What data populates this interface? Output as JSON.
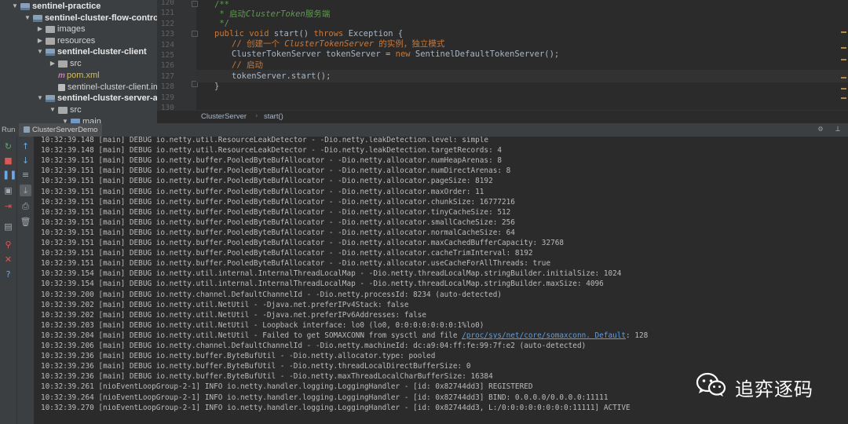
{
  "project_tree": {
    "items": [
      {
        "label": "sentinel-practice",
        "arrow": "▼",
        "icon": "module",
        "depth": 0,
        "bold": true
      },
      {
        "label": "sentinel-cluster-flow-control",
        "arrow": "▼",
        "icon": "module",
        "depth": 1,
        "bold": true
      },
      {
        "label": "images",
        "arrow": "▶",
        "icon": "folder",
        "depth": 2,
        "bold": false
      },
      {
        "label": "resources",
        "arrow": "▶",
        "icon": "folder",
        "depth": 2,
        "bold": false
      },
      {
        "label": "sentinel-cluster-client",
        "arrow": "▼",
        "icon": "module",
        "depth": 2,
        "bold": true
      },
      {
        "label": "src",
        "arrow": "▶",
        "icon": "folder",
        "depth": 3,
        "bold": false
      },
      {
        "label": "pom.xml",
        "arrow": "",
        "icon": "maven",
        "depth": 3,
        "bold": false,
        "pom": true
      },
      {
        "label": "sentinel-cluster-client.iml",
        "arrow": "",
        "icon": "file",
        "depth": 3,
        "bold": false
      },
      {
        "label": "sentinel-cluster-server-alone",
        "arrow": "▼",
        "icon": "module",
        "depth": 2,
        "bold": true
      },
      {
        "label": "src",
        "arrow": "▼",
        "icon": "folder",
        "depth": 3,
        "bold": false
      },
      {
        "label": "main",
        "arrow": "▼",
        "icon": "srcfolder",
        "depth": 4,
        "bold": false
      }
    ]
  },
  "editor": {
    "line_numbers": [
      "120",
      "121",
      "122",
      "123",
      "124",
      "125",
      "126",
      "127",
      "128",
      "129",
      "130"
    ],
    "code": {
      "l120": "/**",
      "l121_prefix": " * 启动",
      "l121_italic": "ClusterToken",
      "l121_suffix": "服务端",
      "l122": " */",
      "l123_kw1": "public void",
      "l123_mid": " start() ",
      "l123_kw2": "throws",
      "l123_end": " Exception {",
      "l124_prefix": "// 创建一个 ",
      "l124_italic": "ClusterTokenServer",
      "l124_suffix": " 的实例，独立模式",
      "l125_a": "ClusterTokenServer tokenServer = ",
      "l125_kw": "new",
      "l125_b": " SentinelDefaultTokenServer();",
      "l126": "// 启动",
      "l127": "tokenServer.start();",
      "l128": "}"
    }
  },
  "breadcrumb": {
    "class_name": "ClusterServer",
    "method": "start()"
  },
  "run_panel": {
    "label": "Run",
    "tab": "ClusterServerDemo",
    "settings_glyph": "⚙",
    "minimize_glyph": "⊥"
  },
  "toolbar_a": [
    {
      "name": "rerun-icon",
      "glyph": "↻",
      "color": "#59a869"
    },
    {
      "name": "stop-icon",
      "glyph": "■",
      "color": "#e05555"
    },
    {
      "name": "pause-icon",
      "glyph": "❚❚",
      "color": "#6aa9e6"
    },
    {
      "name": "dump-threads-icon",
      "glyph": "▣",
      "color": "#a0a8b0"
    },
    {
      "name": "exit-icon",
      "glyph": "⇥",
      "color": "#e05555"
    },
    {
      "name": "layout-icon",
      "glyph": "▤",
      "color": "#a0a8b0"
    },
    {
      "name": "pin-icon",
      "glyph": "⚲",
      "color": "#e05555"
    },
    {
      "name": "close-icon",
      "glyph": "✕",
      "color": "#e05555"
    },
    {
      "name": "help-icon",
      "glyph": "?",
      "color": "#6aa9e6"
    }
  ],
  "toolbar_b": [
    {
      "name": "scroll-up-icon",
      "glyph": "↑",
      "color": "#6aa9e6"
    },
    {
      "name": "scroll-down-icon",
      "glyph": "↓",
      "color": "#6aa9e6"
    },
    {
      "name": "soft-wrap-icon",
      "glyph": "≡",
      "color": "#a0a8b0"
    },
    {
      "name": "scroll-to-end-icon",
      "glyph": "⤓",
      "color": "#a0a8b0"
    },
    {
      "name": "print-icon",
      "glyph": "⎙",
      "color": "#a0a8b0"
    },
    {
      "name": "clear-icon",
      "glyph": "🗑",
      "color": "#a0a8b0"
    }
  ],
  "console_lines": [
    "10:32:39.148 [main] DEBUG io.netty.util.ResourceLeakDetector - -Dio.netty.leakDetection.level: simple",
    "10:32:39.148 [main] DEBUG io.netty.util.ResourceLeakDetector - -Dio.netty.leakDetection.targetRecords: 4",
    "10:32:39.151 [main] DEBUG io.netty.buffer.PooledByteBufAllocator - -Dio.netty.allocator.numHeapArenas: 8",
    "10:32:39.151 [main] DEBUG io.netty.buffer.PooledByteBufAllocator - -Dio.netty.allocator.numDirectArenas: 8",
    "10:32:39.151 [main] DEBUG io.netty.buffer.PooledByteBufAllocator - -Dio.netty.allocator.pageSize: 8192",
    "10:32:39.151 [main] DEBUG io.netty.buffer.PooledByteBufAllocator - -Dio.netty.allocator.maxOrder: 11",
    "10:32:39.151 [main] DEBUG io.netty.buffer.PooledByteBufAllocator - -Dio.netty.allocator.chunkSize: 16777216",
    "10:32:39.151 [main] DEBUG io.netty.buffer.PooledByteBufAllocator - -Dio.netty.allocator.tinyCacheSize: 512",
    "10:32:39.151 [main] DEBUG io.netty.buffer.PooledByteBufAllocator - -Dio.netty.allocator.smallCacheSize: 256",
    "10:32:39.151 [main] DEBUG io.netty.buffer.PooledByteBufAllocator - -Dio.netty.allocator.normalCacheSize: 64",
    "10:32:39.151 [main] DEBUG io.netty.buffer.PooledByteBufAllocator - -Dio.netty.allocator.maxCachedBufferCapacity: 32768",
    "10:32:39.151 [main] DEBUG io.netty.buffer.PooledByteBufAllocator - -Dio.netty.allocator.cacheTrimInterval: 8192",
    "10:32:39.151 [main] DEBUG io.netty.buffer.PooledByteBufAllocator - -Dio.netty.allocator.useCacheForAllThreads: true",
    "10:32:39.154 [main] DEBUG io.netty.util.internal.InternalThreadLocalMap - -Dio.netty.threadLocalMap.stringBuilder.initialSize: 1024",
    "10:32:39.154 [main] DEBUG io.netty.util.internal.InternalThreadLocalMap - -Dio.netty.threadLocalMap.stringBuilder.maxSize: 4096",
    "10:32:39.200 [main] DEBUG io.netty.channel.DefaultChannelId - -Dio.netty.processId: 8234 (auto-detected)",
    "10:32:39.202 [main] DEBUG io.netty.util.NetUtil - -Djava.net.preferIPv4Stack: false",
    "10:32:39.202 [main] DEBUG io.netty.util.NetUtil - -Djava.net.preferIPv6Addresses: false",
    "10:32:39.203 [main] DEBUG io.netty.util.NetUtil - Loopback interface: lo0 (lo0, 0:0:0:0:0:0:0:1%lo0)",
    "LINK",
    "10:32:39.206 [main] DEBUG io.netty.channel.DefaultChannelId - -Dio.netty.machineId: dc:a9:04:ff:fe:99:7f:e2 (auto-detected)",
    "10:32:39.236 [main] DEBUG io.netty.buffer.ByteBufUtil - -Dio.netty.allocator.type: pooled",
    "10:32:39.236 [main] DEBUG io.netty.buffer.ByteBufUtil - -Dio.netty.threadLocalDirectBufferSize: 0",
    "10:32:39.236 [main] DEBUG io.netty.buffer.ByteBufUtil - -Dio.netty.maxThreadLocalCharBufferSize: 16384",
    "10:32:39.261 [nioEventLoopGroup-2-1] INFO io.netty.handler.logging.LoggingHandler - [id: 0x82744dd3] REGISTERED",
    "10:32:39.264 [nioEventLoopGroup-2-1] INFO io.netty.handler.logging.LoggingHandler - [id: 0x82744dd3] BIND: 0.0.0.0/0.0.0.0:11111",
    "10:32:39.270 [nioEventLoopGroup-2-1] INFO io.netty.handler.logging.LoggingHandler - [id: 0x82744dd3, L:/0:0:0:0:0:0:0:0:11111] ACTIVE"
  ],
  "console_link_line": {
    "prefix": "10:32:39.204 [main] DEBUG io.netty.util.NetUtil - Failed to get SOMAXCONN from sysctl and file ",
    "link": "/proc/sys/net/core/somaxconn. Default",
    "suffix": ": 128"
  },
  "watermark": {
    "text": "追弈逐码"
  }
}
